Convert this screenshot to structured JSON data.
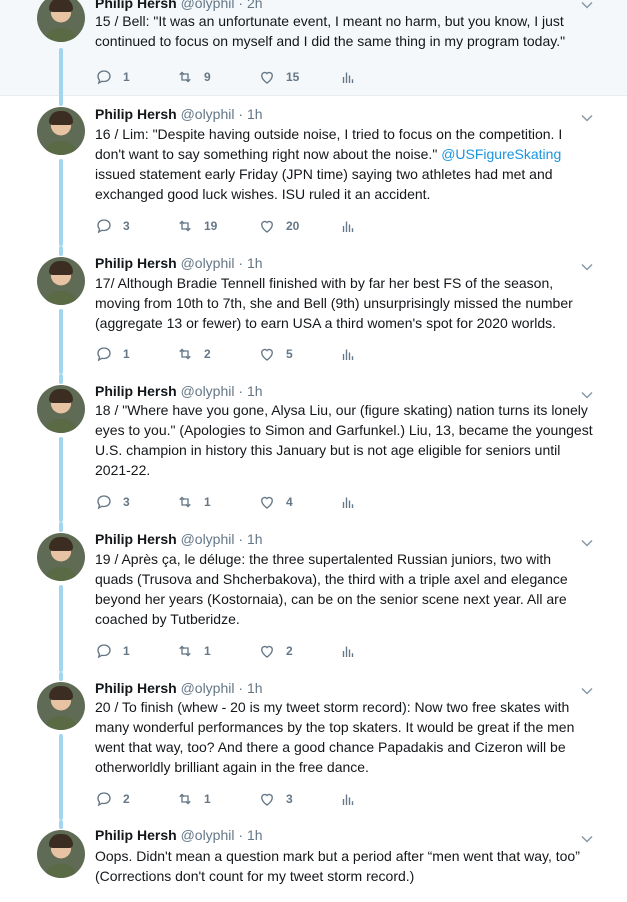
{
  "tweets": [
    {
      "name": "Philip Hersh",
      "handle": "@olyphil",
      "time": "2h",
      "lines": [
        "15 /  Bell: \"It was an unfortunate event, I meant no harm, but you know, I just",
        "continued to focus on myself and I did the same thing in my program today.\""
      ],
      "replies": "1",
      "retweets": "9",
      "likes": "15"
    },
    {
      "name": "Philip Hersh",
      "handle": "@olyphil",
      "time": "1h",
      "lines": [
        "16 / Lim: \"Despite having outside noise, I tried to focus on the competition. I",
        "don't want to say something right now about the noise.\" ",
        "issued statement early Friday (JPN time) saying two athletes had met and",
        "exchanged good luck wishes.  ISU ruled it an accident."
      ],
      "mention": "@USFigureSkating",
      "replies": "3",
      "retweets": "19",
      "likes": "20"
    },
    {
      "name": "Philip Hersh",
      "handle": "@olyphil",
      "time": "1h",
      "lines": [
        "17/ Although Bradie Tennell finished with by far her best FS of the season,",
        "moving from 10th to 7th, she and Bell (9th) unsurprisingly missed the number",
        "(aggregate 13 or fewer) to earn USA a third women's spot for 2020 worlds."
      ],
      "replies": "1",
      "retweets": "2",
      "likes": "5"
    },
    {
      "name": "Philip Hersh",
      "handle": "@olyphil",
      "time": "1h",
      "lines": [
        "18 / \"Where have you gone, Alysa Liu, our (figure skating) nation turns its lonely",
        "eyes to you.\" (Apologies to Simon and Garfunkel.) Liu, 13, became the youngest",
        "U.S. champion in history this January but is not age eligible for seniors until",
        "2021-22."
      ],
      "replies": "3",
      "retweets": "1",
      "likes": "4"
    },
    {
      "name": "Philip Hersh",
      "handle": "@olyphil",
      "time": "1h",
      "lines": [
        "19 / Après ça, le déluge: the three supertalented Russian juniors, two with",
        "quads (Trusova and Shcherbakova), the third with a triple axel and elegance",
        "beyond her years (Kostornaia),  can be on the senior scene next year.  All are",
        "coached by Tutberidze."
      ],
      "replies": "1",
      "retweets": "1",
      "likes": "2"
    },
    {
      "name": "Philip Hersh",
      "handle": "@olyphil",
      "time": "1h",
      "lines": [
        "20 / To finish (whew - 20 is my tweet storm record):  Now two free skates with",
        "many wonderful performances by the top skaters.  It would be great if the men",
        "went that way, too?  And there a good chance Papadakis and Cizeron will be",
        "otherworldly brilliant again in the free dance."
      ],
      "replies": "2",
      "retweets": "1",
      "likes": "3"
    },
    {
      "name": "Philip Hersh",
      "handle": "@olyphil",
      "time": "1h",
      "lines": [
        "Oops.  Didn't mean a question mark but a period after “men went that way, too”",
        "(Corrections don't count for my tweet storm record.)"
      ]
    }
  ],
  "colors": {
    "thread_line": "#a2d6f0",
    "mention": "#1b95e0",
    "muted": "#657786"
  },
  "icons": [
    "reply-icon",
    "retweet-icon",
    "like-icon",
    "analytics-icon",
    "chevron-down-icon"
  ]
}
